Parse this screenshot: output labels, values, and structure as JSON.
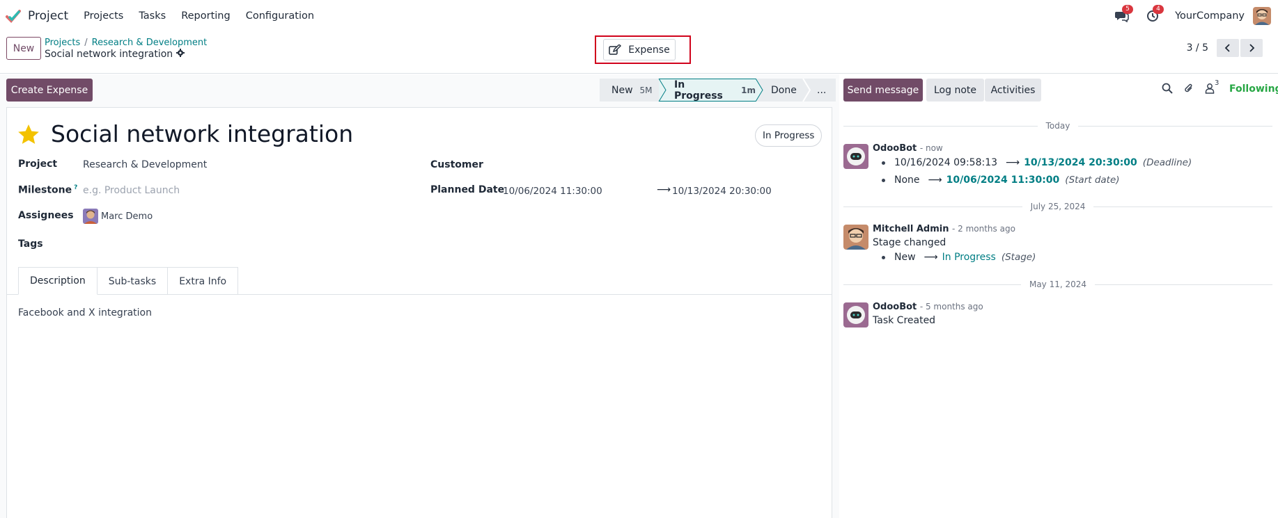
{
  "navbar": {
    "app_name": "Project",
    "menu": [
      "Projects",
      "Tasks",
      "Reporting",
      "Configuration"
    ],
    "messages_badge": "5",
    "activities_badge": "4",
    "company": "YourCompany"
  },
  "control_panel": {
    "new_label": "New",
    "breadcrumb": [
      "Projects",
      "Research & Development"
    ],
    "record_name": "Social network integration",
    "expense_label": "Expense",
    "pager": "3 / 5"
  },
  "form": {
    "create_expense_label": "Create Expense",
    "stages": [
      {
        "label": "New",
        "duration": "5M"
      },
      {
        "label": "In Progress",
        "duration": "1m"
      },
      {
        "label": "Done",
        "duration": ""
      },
      {
        "label": "...",
        "duration": ""
      }
    ],
    "title": "Social network integration",
    "state": "In Progress",
    "fields": {
      "project_label": "Project",
      "project_value": "Research & Development",
      "milestone_label": "Milestone",
      "milestone_help": "?",
      "milestone_placeholder": "e.g. Product Launch",
      "assignees_label": "Assignees",
      "assignee_name": "Marc Demo",
      "tags_label": "Tags",
      "customer_label": "Customer",
      "planned_date_label": "Planned Date",
      "planned_start": "10/06/2024 11:30:00",
      "planned_end": "10/13/2024 20:30:00"
    },
    "tabs": [
      "Description",
      "Sub-tasks",
      "Extra Info"
    ],
    "description": "Facebook and X integration"
  },
  "chatter": {
    "send_message_label": "Send message",
    "log_note_label": "Log note",
    "activities_label": "Activities",
    "followers_count": "3",
    "following_label": "Following",
    "groups": [
      {
        "date": "Today",
        "author": "OdooBot",
        "when": "- now",
        "changes": [
          {
            "old": "10/16/2024 09:58:13",
            "new": "10/13/2024 20:30:00",
            "field": "(Deadline)"
          },
          {
            "old": "None",
            "new": "10/06/2024 11:30:00",
            "field": "(Start date)"
          }
        ]
      },
      {
        "date": "July 25, 2024",
        "author": "Mitchell Admin",
        "when": "- 2 months ago",
        "body": "Stage changed",
        "changes": [
          {
            "old": "New",
            "new": "In Progress",
            "field": "(Stage)"
          }
        ]
      },
      {
        "date": "May 11, 2024",
        "author": "OdooBot",
        "when": "- 5 months ago",
        "body": "Task Created"
      }
    ]
  },
  "colors": {
    "brand": "#714b67",
    "link": "#017e84",
    "following": "#28a745",
    "badge": "#d9363e",
    "highlight": "#d0021b"
  }
}
